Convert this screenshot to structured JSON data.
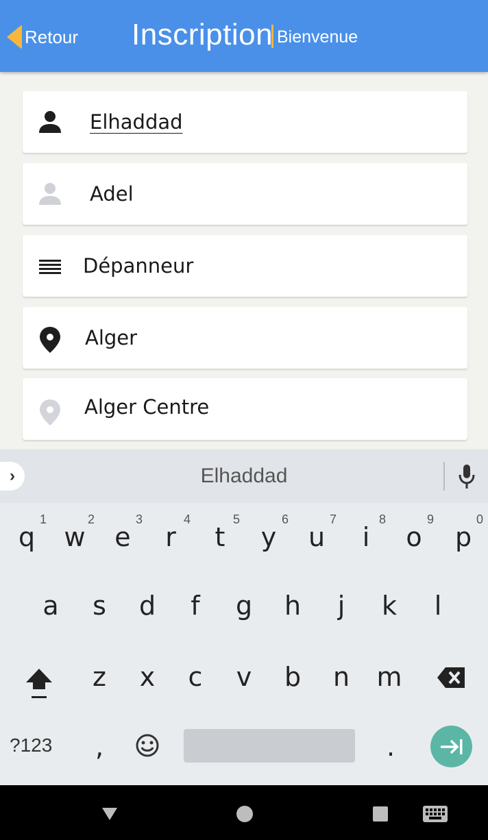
{
  "header": {
    "back_label": "Retour",
    "title": "Inscription",
    "subtitle": "Bienvenue",
    "colors": {
      "bar": "#4a90e8",
      "accent": "#f6b73c"
    }
  },
  "form": {
    "fields": [
      {
        "icon": "person-icon",
        "value": "Elhaddad"
      },
      {
        "icon": "person-outline-icon",
        "value": "Adel"
      },
      {
        "icon": "list-icon",
        "value": "Dépanneur"
      },
      {
        "icon": "location-pin-icon",
        "value": "Alger"
      },
      {
        "icon": "location-pin-outline-icon",
        "value": "Alger Centre"
      }
    ]
  },
  "keyboard": {
    "suggestion": "Elhaddad",
    "row1": [
      "q",
      "w",
      "e",
      "r",
      "t",
      "y",
      "u",
      "i",
      "o",
      "p"
    ],
    "row1_hints": [
      "1",
      "2",
      "3",
      "4",
      "5",
      "6",
      "7",
      "8",
      "9",
      "0"
    ],
    "row2": [
      "a",
      "s",
      "d",
      "f",
      "g",
      "h",
      "j",
      "k",
      "l"
    ],
    "row3": [
      "z",
      "x",
      "c",
      "v",
      "b",
      "n",
      "m"
    ],
    "symbols_label": "?123",
    "comma": ",",
    "period": ".",
    "enter_color": "#5bb6a6"
  },
  "navbar": {
    "icons": [
      "back-triangle-icon",
      "home-circle-icon",
      "recents-square-icon",
      "keyboard-switch-icon"
    ]
  }
}
